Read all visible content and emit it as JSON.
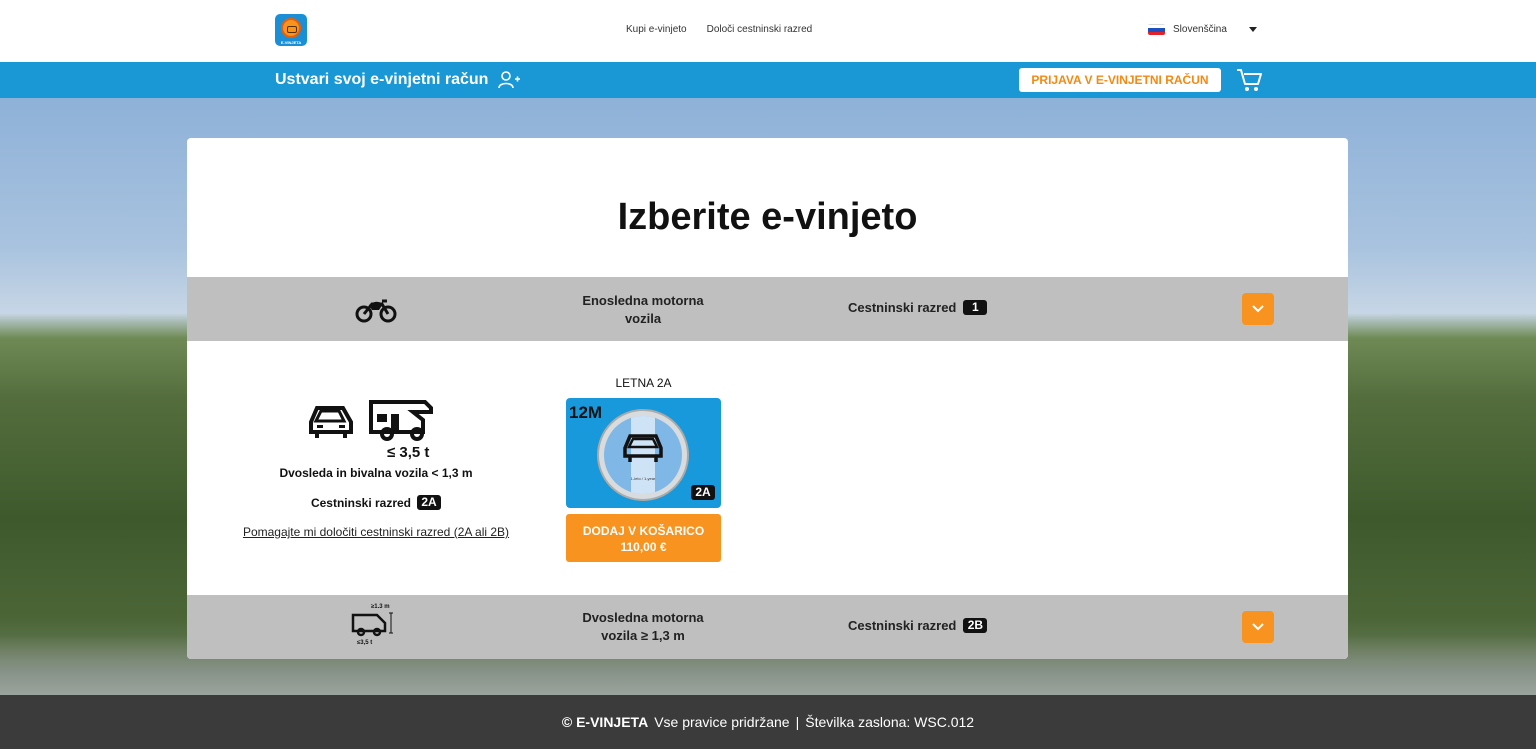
{
  "header": {
    "logo_text": "E-VINJETA",
    "nav": [
      "Kupi e-vinjeto",
      "Določi cestninski razred"
    ],
    "language": "Slovenščina"
  },
  "account_bar": {
    "create_account": "Ustvari svoj e-vinjetni račun",
    "login_button": "PRIJAVA V E-VINJETNI RAČUN"
  },
  "main": {
    "title": "Izberite e-vinjeto",
    "categories": [
      {
        "name": "Enosledna motorna vozila",
        "class_label": "Cestninski razred",
        "class_badge": "1",
        "icon": "motorcycle-icon"
      },
      {
        "name": "Dvosledna motorna vozila ≥ 1,3 m",
        "class_label": "Cestninski razred",
        "class_badge": "2B",
        "icon": "van-icon",
        "icon_height": "≥1.3 m",
        "icon_weight": "≤3,5 t"
      }
    ],
    "expanded": {
      "weight": "≤ 3,5 t",
      "description": "Dvosleda in bivalna vozila < 1,3 m",
      "class_label": "Cestninski razred",
      "class_badge": "2A",
      "help_link": "Pomagajte mi določiti cestninski razred (2A ali 2B)",
      "product": {
        "title": "LETNA 2A",
        "vignette_duration": "12M",
        "vignette_year_text": "1-leto / 1-year",
        "vignette_badge": "2A",
        "add_label": "DODAJ V KOŠARICO",
        "price": "110,00 €"
      }
    }
  },
  "footer": {
    "brand": "© E-VINJETA",
    "rights": "Vse pravice pridržane",
    "separator": "|",
    "screen_number": "Številka zaslona: WSC.012"
  },
  "colors": {
    "accent_orange": "#f7931e",
    "bar_blue": "#1a98d5",
    "row_gray": "#bfbfbf",
    "footer_dark": "#3b3b3b"
  }
}
